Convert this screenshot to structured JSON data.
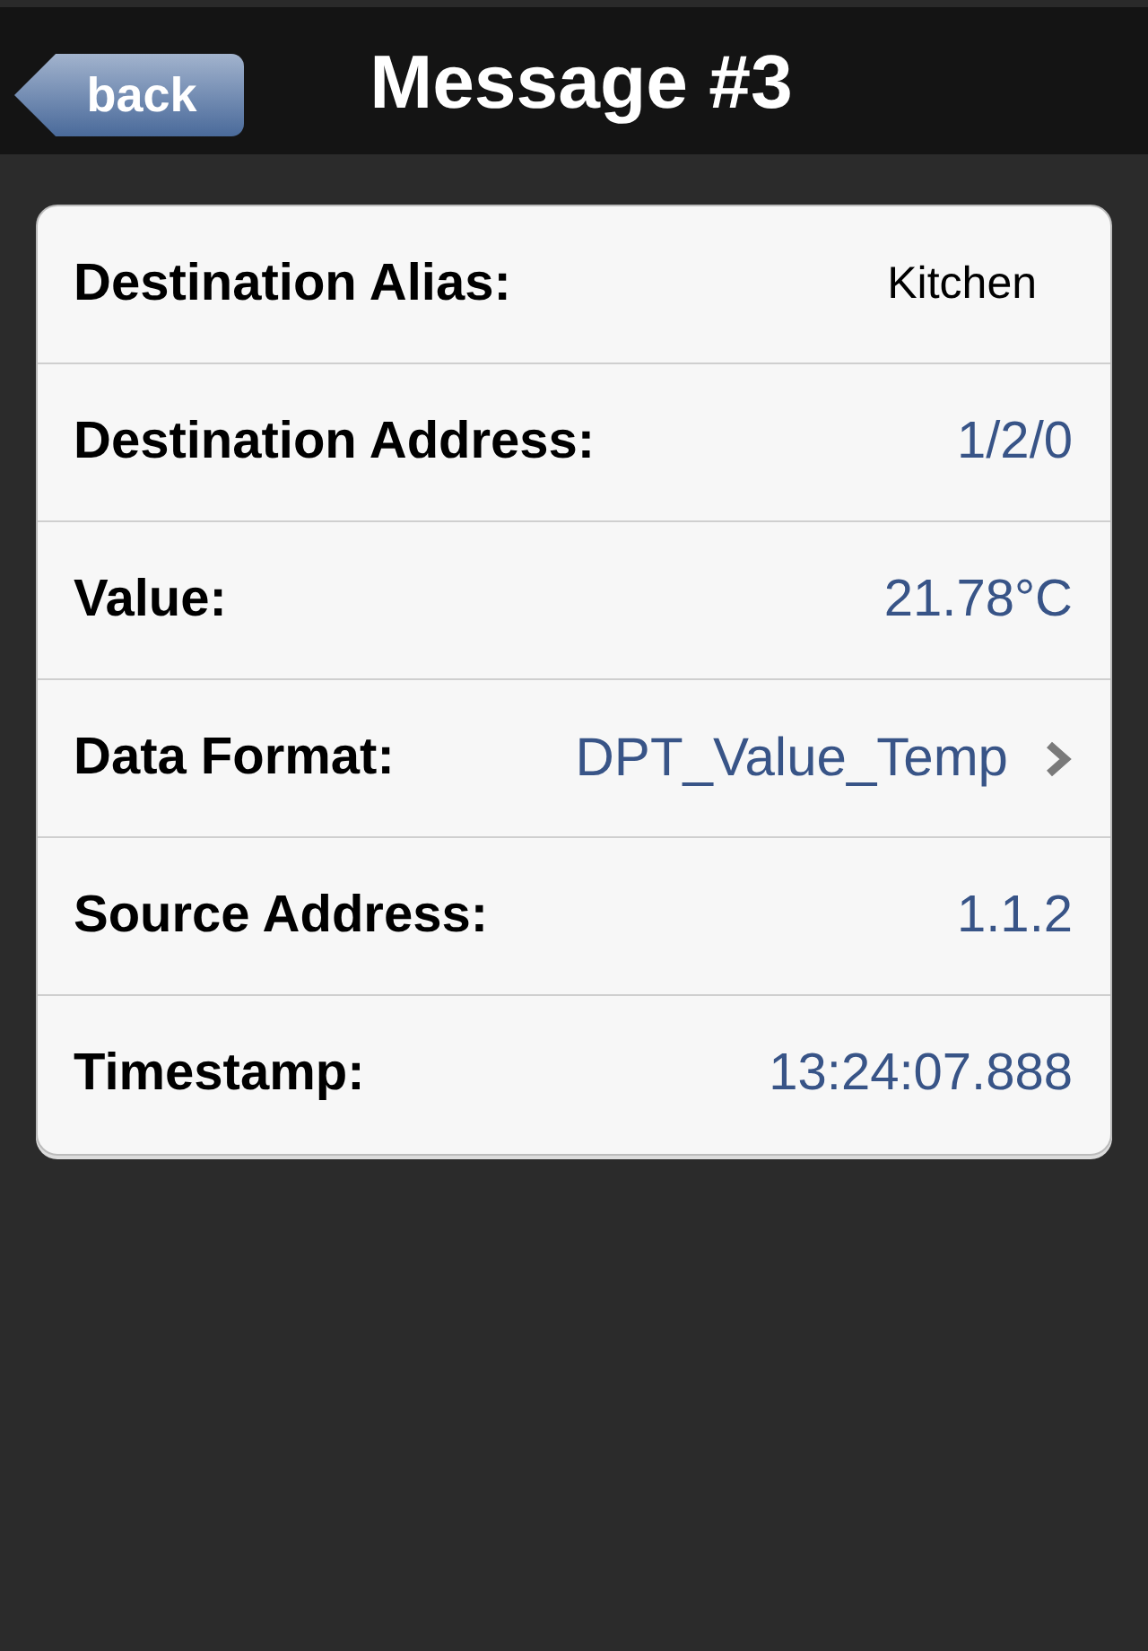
{
  "nav": {
    "back": "back",
    "title": "Message #3"
  },
  "rows": [
    {
      "kind": "plain",
      "label": "Destination Alias:",
      "value": "Kitchen"
    },
    {
      "kind": "value",
      "label": "Destination Address:",
      "value": "1/2/0"
    },
    {
      "kind": "value",
      "label": "Value:",
      "value": "21.78°C"
    },
    {
      "kind": "link",
      "label": "Data Format:",
      "value": "DPT_Value_Temp"
    },
    {
      "kind": "value",
      "label": "Source Address:",
      "value": "1.1.2"
    },
    {
      "kind": "value",
      "label": "Timestamp:",
      "value": "13:24:07.888"
    }
  ]
}
